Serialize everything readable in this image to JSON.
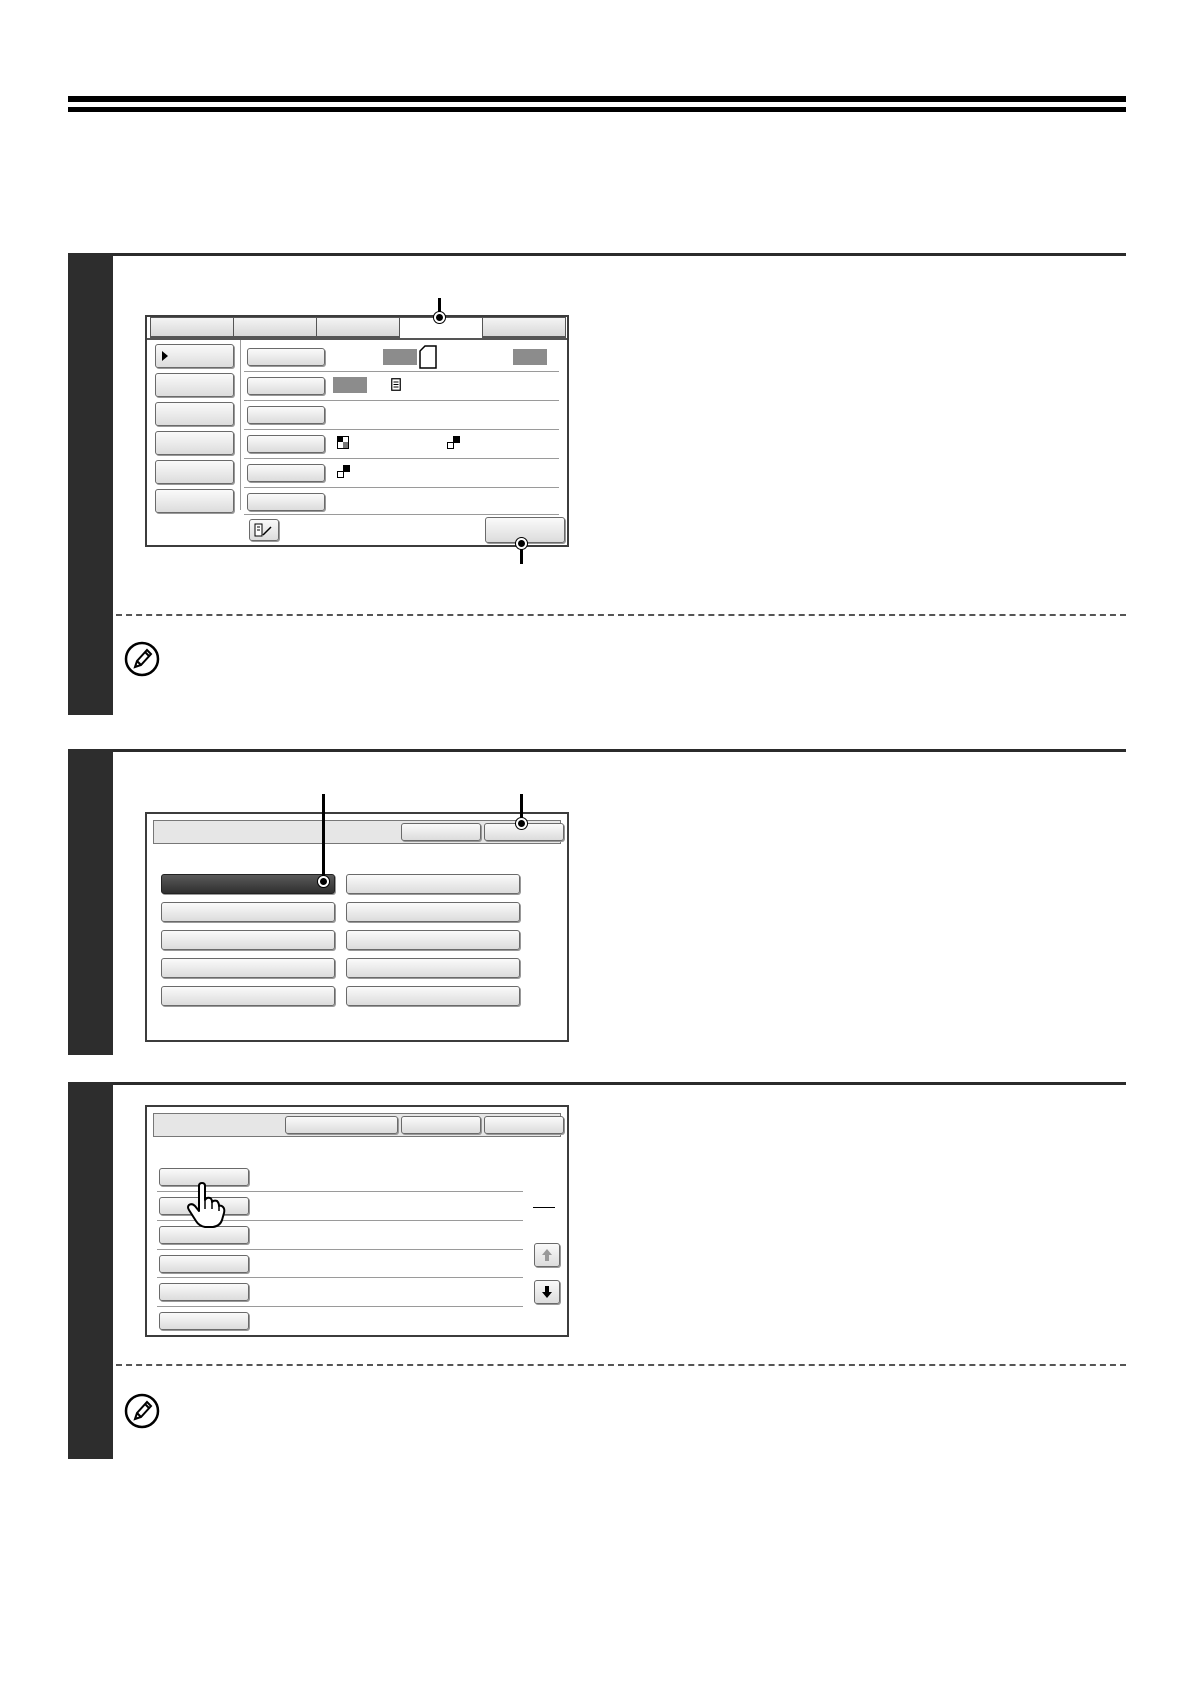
{
  "step1": {
    "screen": {
      "tabs": 5,
      "active_tab": 4,
      "left_buttons": 6,
      "rows": 6
    }
  },
  "step2": {
    "screen": {
      "header_buttons": 2,
      "grid_rows": 5,
      "grid_cols": 2,
      "selected_index": 0
    }
  },
  "step3": {
    "screen": {
      "header_buttons": 3,
      "list_rows": 6
    }
  },
  "icons": {
    "note": "pencil-note-icon",
    "touch": "pointing-hand-icon",
    "scroll_up": "arrow-up-icon",
    "scroll_down": "arrow-down-icon"
  },
  "colors": {
    "step_bar": "#2d2d2d",
    "selected_button": "#3a3a3a"
  }
}
